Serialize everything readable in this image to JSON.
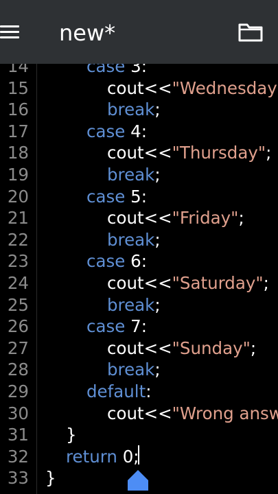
{
  "header": {
    "title": "new*",
    "menu_icon": "hamburger-menu-icon",
    "folder_icon": "folder-icon"
  },
  "colors": {
    "header_bg": "#2e3134",
    "editor_bg": "#000000",
    "keyword": "#5f8fd4",
    "string": "#e0a08d",
    "line_number": "#8b8b8b",
    "cursor_handle": "#4d8df5"
  },
  "code_lines": [
    {
      "n": "14",
      "indent": 4,
      "tokens": [
        {
          "t": "kw",
          "v": "case"
        },
        {
          "t": "plain",
          "v": " 3:"
        }
      ]
    },
    {
      "n": "15",
      "indent": 5,
      "tokens": [
        {
          "t": "plain",
          "v": "cout<<"
        },
        {
          "t": "str",
          "v": "\"Wednesday"
        }
      ]
    },
    {
      "n": "16",
      "indent": 5,
      "tokens": [
        {
          "t": "kw",
          "v": "break"
        },
        {
          "t": "plain",
          "v": ";"
        }
      ]
    },
    {
      "n": "17",
      "indent": 4,
      "tokens": [
        {
          "t": "kw",
          "v": "case"
        },
        {
          "t": "plain",
          "v": " 4:"
        }
      ]
    },
    {
      "n": "18",
      "indent": 5,
      "tokens": [
        {
          "t": "plain",
          "v": "cout<<"
        },
        {
          "t": "str",
          "v": "\"Thursday\""
        },
        {
          "t": "plain",
          "v": ";"
        }
      ]
    },
    {
      "n": "19",
      "indent": 5,
      "tokens": [
        {
          "t": "kw",
          "v": "break"
        },
        {
          "t": "plain",
          "v": ";"
        }
      ]
    },
    {
      "n": "20",
      "indent": 4,
      "tokens": [
        {
          "t": "kw",
          "v": "case"
        },
        {
          "t": "plain",
          "v": " 5:"
        }
      ]
    },
    {
      "n": "21",
      "indent": 5,
      "tokens": [
        {
          "t": "plain",
          "v": "cout<<"
        },
        {
          "t": "str",
          "v": "\"Friday\""
        },
        {
          "t": "plain",
          "v": ";"
        }
      ]
    },
    {
      "n": "22",
      "indent": 5,
      "tokens": [
        {
          "t": "kw",
          "v": "break"
        },
        {
          "t": "plain",
          "v": ";"
        }
      ]
    },
    {
      "n": "23",
      "indent": 4,
      "tokens": [
        {
          "t": "kw",
          "v": "case"
        },
        {
          "t": "plain",
          "v": " 6:"
        }
      ]
    },
    {
      "n": "24",
      "indent": 5,
      "tokens": [
        {
          "t": "plain",
          "v": "cout<<"
        },
        {
          "t": "str",
          "v": "\"Saturday\""
        },
        {
          "t": "plain",
          "v": ";"
        }
      ]
    },
    {
      "n": "25",
      "indent": 5,
      "tokens": [
        {
          "t": "kw",
          "v": "break"
        },
        {
          "t": "plain",
          "v": ";"
        }
      ]
    },
    {
      "n": "26",
      "indent": 4,
      "tokens": [
        {
          "t": "kw",
          "v": "case"
        },
        {
          "t": "plain",
          "v": " 7:"
        }
      ]
    },
    {
      "n": "27",
      "indent": 5,
      "tokens": [
        {
          "t": "plain",
          "v": "cout<<"
        },
        {
          "t": "str",
          "v": "\"Sunday\""
        },
        {
          "t": "plain",
          "v": ";"
        }
      ]
    },
    {
      "n": "28",
      "indent": 5,
      "tokens": [
        {
          "t": "kw",
          "v": "break"
        },
        {
          "t": "plain",
          "v": ";"
        }
      ]
    },
    {
      "n": "29",
      "indent": 4,
      "tokens": [
        {
          "t": "kw",
          "v": "default"
        },
        {
          "t": "plain",
          "v": ":"
        }
      ]
    },
    {
      "n": "30",
      "indent": 5,
      "tokens": [
        {
          "t": "plain",
          "v": "cout<<"
        },
        {
          "t": "str",
          "v": "\"Wrong answ"
        }
      ]
    },
    {
      "n": "31",
      "indent": 3,
      "tokens": [
        {
          "t": "plain",
          "v": "}"
        }
      ]
    },
    {
      "n": "32",
      "indent": 3,
      "tokens": [
        {
          "t": "kw",
          "v": "return"
        },
        {
          "t": "plain",
          "v": " 0;"
        }
      ]
    },
    {
      "n": "33",
      "indent": 2,
      "tokens": [
        {
          "t": "plain",
          "v": "}"
        }
      ]
    }
  ]
}
